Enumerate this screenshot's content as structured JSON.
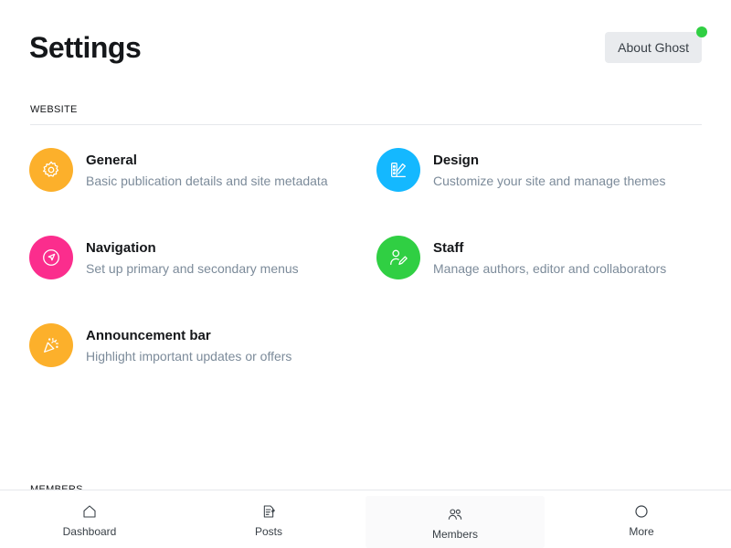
{
  "header": {
    "title": "Settings",
    "about_button": "About Ghost",
    "notification_color": "#30cf43"
  },
  "website_section": {
    "label": "WEBSITE",
    "items": [
      {
        "title": "General",
        "description": "Basic publication details and site metadata",
        "icon": "gear-icon",
        "color": "#fcb02b"
      },
      {
        "title": "Design",
        "description": "Customize your site and manage themes",
        "icon": "palette-icon",
        "color": "#14b8ff"
      },
      {
        "title": "Navigation",
        "description": "Set up primary and secondary menus",
        "icon": "compass-icon",
        "color": "#fb2d8d"
      },
      {
        "title": "Staff",
        "description": "Manage authors, editor and collaborators",
        "icon": "user-edit-icon",
        "color": "#30cf43"
      },
      {
        "title": "Announcement bar",
        "description": "Highlight important updates or offers",
        "icon": "party-popper-icon",
        "color": "#fcb02b"
      }
    ]
  },
  "members_section": {
    "label": "MEMBERS"
  },
  "bottom_nav": {
    "items": [
      {
        "label": "Dashboard",
        "icon": "house-icon"
      },
      {
        "label": "Posts",
        "icon": "posts-icon"
      },
      {
        "label": "Members",
        "icon": "members-icon",
        "active": true
      },
      {
        "label": "More",
        "icon": "more-icon"
      }
    ]
  }
}
